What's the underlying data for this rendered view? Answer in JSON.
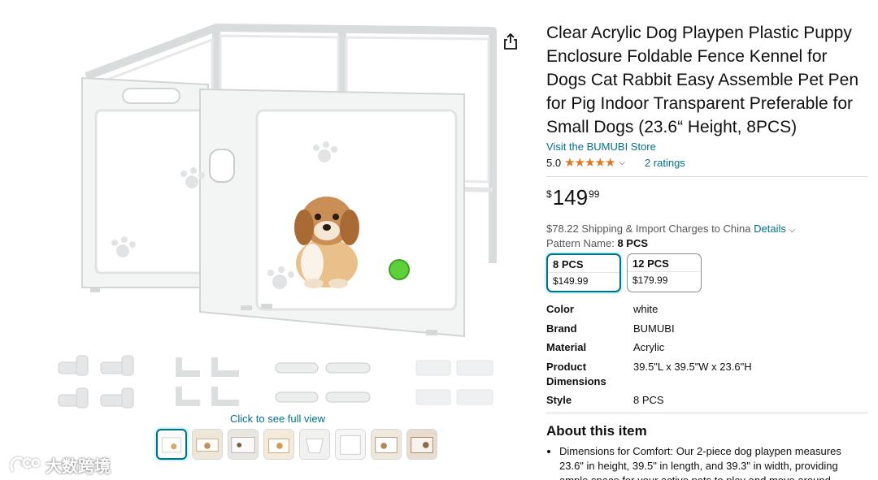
{
  "product": {
    "title": "Clear Acrylic Dog Playpen Plastic Puppy Enclosure Foldable Fence Kennel for Dogs Cat Rabbit Easy Assemble Pet Pen for Pig Indoor Transparent Preferable for Small Dogs (23.6“ Height, 8PCS)",
    "store_link": "Visit the BUMUBI Store",
    "rating_value": "5.0",
    "rating_stars": 5,
    "ratings_count": "2 ratings",
    "price_symbol": "$",
    "price_whole": "149",
    "price_fraction": "99",
    "shipping_text": "$78.22 Shipping & Import Charges to China",
    "shipping_details": "Details",
    "pattern_label": "Pattern Name:",
    "pattern_value": "8 PCS"
  },
  "options": [
    {
      "name": "8 PCS",
      "price": "$149.99",
      "selected": true
    },
    {
      "name": "12 PCS",
      "price": "$179.99",
      "selected": false
    }
  ],
  "specs": [
    {
      "key": "Color",
      "value": "white"
    },
    {
      "key": "Brand",
      "value": "BUMUBI"
    },
    {
      "key": "Material",
      "value": "Acrylic"
    },
    {
      "key": "Product Dimensions",
      "value": "39.5\"L x 39.5\"W x 23.6\"H"
    },
    {
      "key": "Style",
      "value": "8 PCS"
    }
  ],
  "about": {
    "title": "About this item",
    "bullets": [
      "Dimensions for Comfort: Our 2-piece dog playpen measures 23.6\" in height, 39.5\" in length, and 39.3\" in width, providing ample space for your active pets to play and move around comfortably."
    ]
  },
  "gallery": {
    "click_full_view": "Click to see full view",
    "thumbnail_count": 8,
    "selected_thumbnail": 1
  },
  "watermark": "大数跨境",
  "colors": {
    "link": "#007185",
    "star": "#de7921",
    "text": "#0f1111",
    "muted": "#565959",
    "selected_border": "#007185"
  }
}
